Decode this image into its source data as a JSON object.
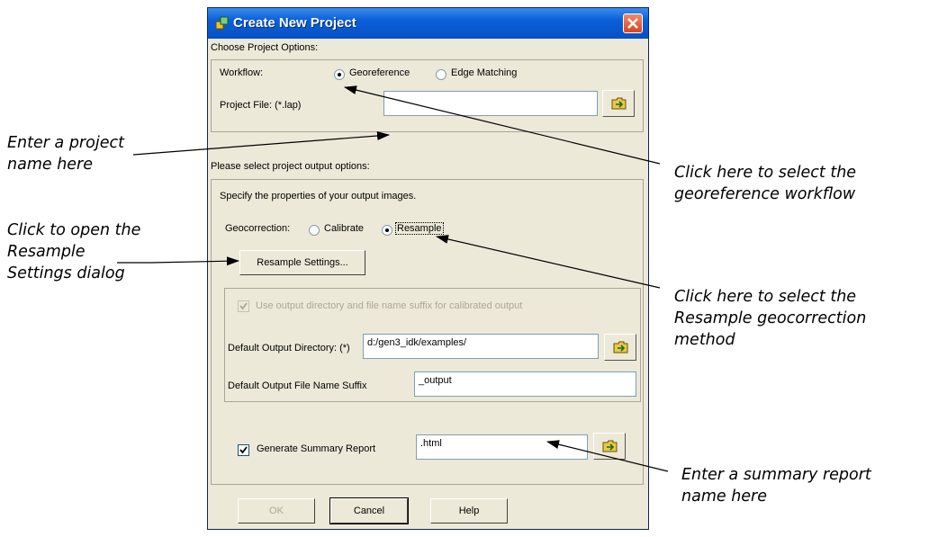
{
  "dialog": {
    "title": "Create New Project",
    "section1_heading": "Choose Project Options:",
    "workflow_label": "Workflow:",
    "workflow_options": [
      "Georeference",
      "Edge Matching"
    ],
    "workflow_selected": "Georeference",
    "project_file_label": "Project File: (*.lap)",
    "project_file_value": "",
    "section2_heading": "Please select project output options:",
    "specify_text": "Specify the properties of your output images.",
    "geocorrection_label": "Geocorrection:",
    "geocorrection_options": [
      "Calibrate",
      "Resample"
    ],
    "geocorrection_selected": "Resample",
    "resample_settings_button": "Resample Settings...",
    "use_output_dir_label": "Use output directory and file name suffix for calibrated output",
    "use_output_dir_checked": true,
    "default_output_dir_label": "Default Output Directory: (*)",
    "default_output_dir_value": "d:/gen3_idk/examples/",
    "default_suffix_label": "Default Output File Name Suffix",
    "default_suffix_value": "_output",
    "generate_summary_label": "Generate Summary Report",
    "generate_summary_checked": true,
    "summary_report_value": ".html",
    "ok_button": "OK",
    "cancel_button": "Cancel",
    "help_button": "Help"
  },
  "annotations": {
    "project_name": [
      "Enter a project",
      "name here"
    ],
    "georeference": [
      "Click here to select the",
      "georeference workflow"
    ],
    "resample_settings": [
      "Click to open the",
      "Resample",
      "Settings dialog"
    ],
    "resample_method": [
      "Click here to select the",
      "Resample geocorrection",
      "method"
    ],
    "summary_report": [
      "Enter a summary report",
      "name here"
    ]
  },
  "colors": {
    "titlebar": "#0a5fd8",
    "dialog_face": "#ece9d8",
    "close_button": "#d9441c"
  }
}
